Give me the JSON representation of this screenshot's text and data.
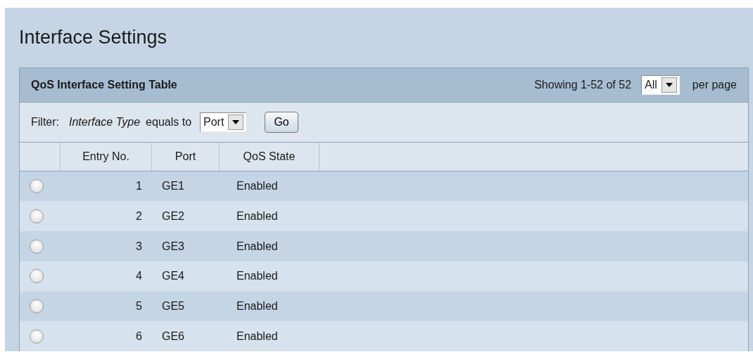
{
  "page": {
    "title": "Interface Settings"
  },
  "table": {
    "title": "QoS Interface Setting Table",
    "showing": "Showing 1-52 of 52",
    "per_page": {
      "value": "All",
      "suffix": "per page"
    },
    "filter": {
      "label": "Filter:",
      "field": "Interface Type",
      "operator": "equals to",
      "value": "Port",
      "button": "Go"
    },
    "columns": [
      "",
      "Entry No.",
      "Port",
      "QoS State"
    ],
    "rows": [
      {
        "selected": false,
        "entry": "1",
        "port": "GE1",
        "state": "Enabled"
      },
      {
        "selected": false,
        "entry": "2",
        "port": "GE2",
        "state": "Enabled"
      },
      {
        "selected": false,
        "entry": "3",
        "port": "GE3",
        "state": "Enabled"
      },
      {
        "selected": false,
        "entry": "4",
        "port": "GE4",
        "state": "Enabled"
      },
      {
        "selected": false,
        "entry": "5",
        "port": "GE5",
        "state": "Enabled"
      },
      {
        "selected": false,
        "entry": "6",
        "port": "GE6",
        "state": "Enabled"
      }
    ]
  }
}
